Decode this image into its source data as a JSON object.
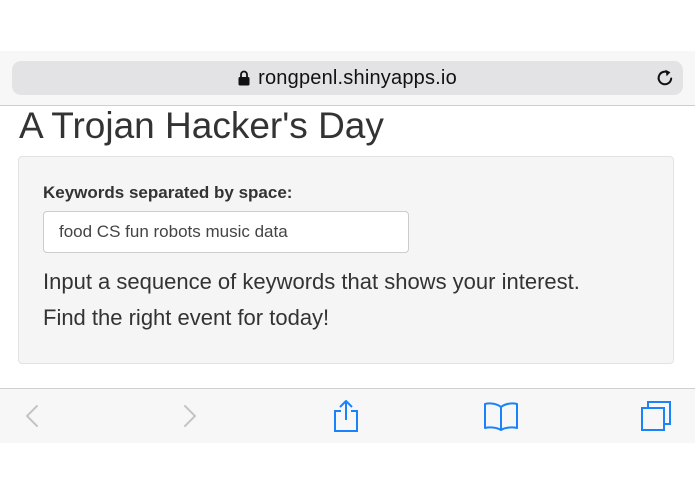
{
  "browser": {
    "address": "rongpenl.shinyapps.io",
    "icons": {
      "lock": "lock-icon",
      "reload": "reload-icon",
      "back": "chevron-left-icon",
      "forward": "chevron-right-icon",
      "share": "share-icon",
      "bookmarks": "book-icon",
      "tabs": "tabs-icon"
    },
    "accent_color": "#1a82fb",
    "disabled_color": "#c4c4c4"
  },
  "page": {
    "title": "A Trojan Hacker's Day",
    "form": {
      "label": "Keywords separated by space:",
      "input_value": "food CS fun robots music data"
    },
    "help": {
      "line1": "Input a sequence of keywords that shows your interest.",
      "line2": "Find the right event for today!"
    }
  }
}
